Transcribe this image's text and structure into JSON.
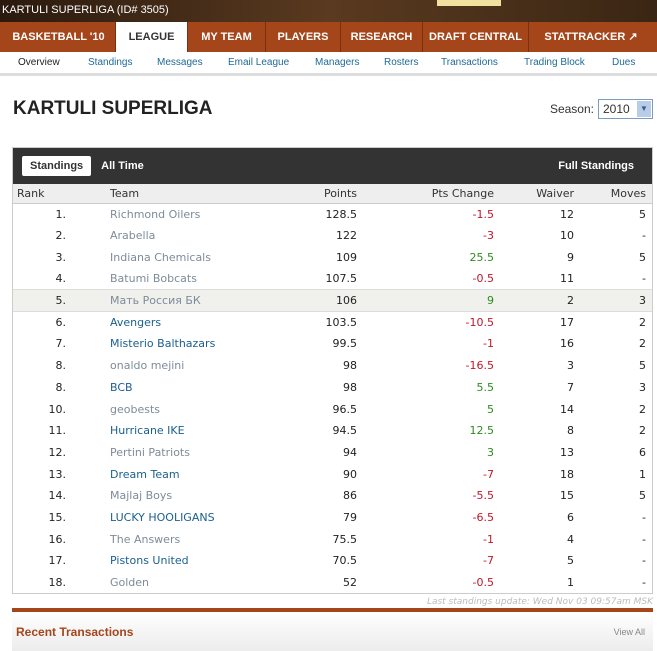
{
  "window_title": "KARTULI SUPERLIGA (ID# 3505)",
  "nav": [
    "BASKETBALL '10",
    "LEAGUE",
    "MY TEAM",
    "PLAYERS",
    "RESEARCH",
    "DRAFT CENTRAL",
    "STATTRACKER"
  ],
  "subnav": [
    "Overview",
    "Standings",
    "Messages",
    "Email League",
    "Managers",
    "Rosters",
    "Transactions",
    "Trading Block",
    "Dues"
  ],
  "page_title": "KARTULI SUPERLIGA",
  "season": {
    "label": "Season:",
    "value": "2010"
  },
  "standings": {
    "tabs": [
      "Standings",
      "All Time"
    ],
    "full_link": "Full Standings",
    "headers": [
      "Rank",
      "Team",
      "Points",
      "Pts Change",
      "Waiver",
      "Moves"
    ],
    "rows": [
      {
        "rank": "1.",
        "team": "Richmond Oilers",
        "points": "128.5",
        "change": "-1.5",
        "waiver": "12",
        "moves": "5",
        "link": false
      },
      {
        "rank": "2.",
        "team": "Arabella",
        "points": "122",
        "change": "-3",
        "waiver": "10",
        "moves": "-",
        "link": false
      },
      {
        "rank": "3.",
        "team": "Indiana Chemicals",
        "points": "109",
        "change": "25.5",
        "waiver": "9",
        "moves": "5",
        "link": false
      },
      {
        "rank": "4.",
        "team": "Batumi Bobcats",
        "points": "107.5",
        "change": "-0.5",
        "waiver": "11",
        "moves": "-",
        "link": false
      },
      {
        "rank": "5.",
        "team": "Мать Россия БК",
        "points": "106",
        "change": "9",
        "waiver": "2",
        "moves": "3",
        "link": false,
        "highlight": true
      },
      {
        "rank": "6.",
        "team": "Avengers",
        "points": "103.5",
        "change": "-10.5",
        "waiver": "17",
        "moves": "2",
        "link": true
      },
      {
        "rank": "7.",
        "team": "Misterio Balthazars",
        "points": "99.5",
        "change": "-1",
        "waiver": "16",
        "moves": "2",
        "link": true
      },
      {
        "rank": "8.",
        "team": "onaldo mejini",
        "points": "98",
        "change": "-16.5",
        "waiver": "3",
        "moves": "5",
        "link": false
      },
      {
        "rank": "8.",
        "team": "BCB",
        "points": "98",
        "change": "5.5",
        "waiver": "7",
        "moves": "3",
        "link": true
      },
      {
        "rank": "10.",
        "team": "geobests",
        "points": "96.5",
        "change": "5",
        "waiver": "14",
        "moves": "2",
        "link": false
      },
      {
        "rank": "11.",
        "team": "Hurricane IKE",
        "points": "94.5",
        "change": "12.5",
        "waiver": "8",
        "moves": "2",
        "link": true
      },
      {
        "rank": "12.",
        "team": "Pertini Patriots",
        "points": "94",
        "change": "3",
        "waiver": "13",
        "moves": "6",
        "link": false
      },
      {
        "rank": "13.",
        "team": "Dream Team",
        "points": "90",
        "change": "-7",
        "waiver": "18",
        "moves": "1",
        "link": true
      },
      {
        "rank": "14.",
        "team": "Majlaj Boys",
        "points": "86",
        "change": "-5.5",
        "waiver": "15",
        "moves": "5",
        "link": false
      },
      {
        "rank": "15.",
        "team": "LUCKY HOOLIGANS",
        "points": "79",
        "change": "-6.5",
        "waiver": "6",
        "moves": "-",
        "link": true
      },
      {
        "rank": "16.",
        "team": "The Answers",
        "points": "75.5",
        "change": "-1",
        "waiver": "4",
        "moves": "-",
        "link": false
      },
      {
        "rank": "17.",
        "team": "Pistons United",
        "points": "70.5",
        "change": "-7",
        "waiver": "5",
        "moves": "-",
        "link": true
      },
      {
        "rank": "18.",
        "team": "Golden",
        "points": "52",
        "change": "-0.5",
        "waiver": "1",
        "moves": "-",
        "link": false
      }
    ],
    "last_update": "Last standings update: Wed Nov 03 09:57am MSK"
  },
  "recent": {
    "title": "Recent Transactions",
    "view_all": "View All"
  },
  "colors": {
    "accent": "#a4451a",
    "positive": "#2e8b1e",
    "negative": "#c0162a",
    "link": "#1a5f8e"
  }
}
